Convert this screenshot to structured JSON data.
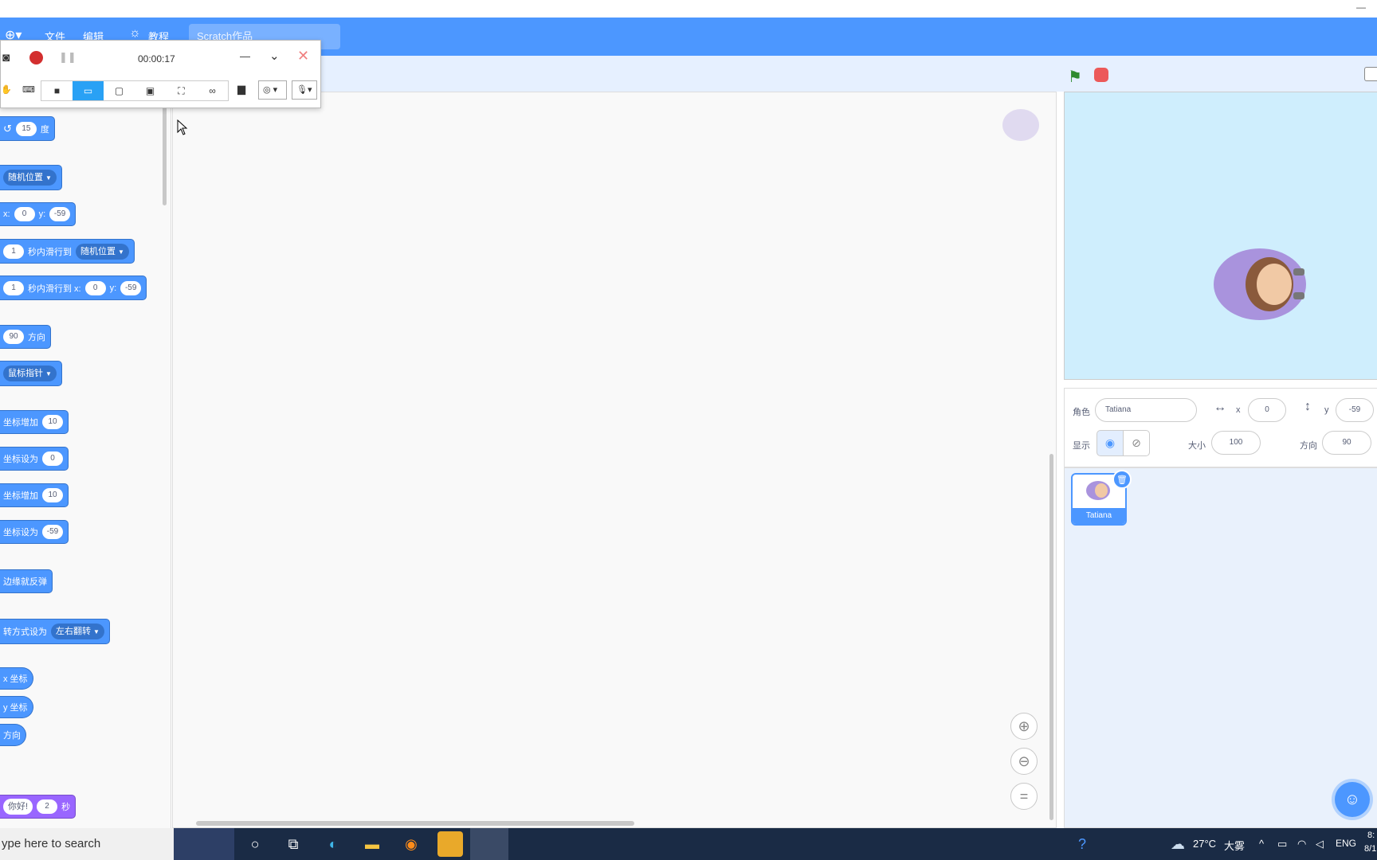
{
  "menubar": {
    "file": "文件",
    "edit": "编辑",
    "tutorials": "教程",
    "project_title": "Scratch作品"
  },
  "recorder": {
    "timer": "00:00:17"
  },
  "palette": {
    "turn_degrees": "15",
    "turn_unit": "度",
    "goto_random": "随机位置",
    "goto_x_label": "x:",
    "goto_x": "0",
    "goto_y_label": "y:",
    "goto_y": "-59",
    "glide_secs": "1",
    "glide_text": "秒内滑行到",
    "glide_random": "随机位置",
    "glide2_secs": "1",
    "glide2_text": "秒内滑行到 x:",
    "glide2_x": "0",
    "glide2_y_label": "y:",
    "glide2_y": "-59",
    "direction_value": "90",
    "direction_text": "方向",
    "point_towards": "鼠标指针",
    "change_x_text": "坐标增加",
    "change_x_value": "10",
    "set_x_text": "坐标设为",
    "set_x_value": "0",
    "change_y_text": "坐标增加",
    "change_y_value": "10",
    "set_y_text": "坐标设为",
    "set_y_value": "-59",
    "bounce_text": "边缘就反弹",
    "rotation_text": "转方式设为",
    "rotation_value": "左右翻转",
    "x_position": "x 坐标",
    "y_position": "y 坐标",
    "direction_reporter": "方向",
    "say_text": "你好!",
    "say_secs": "2",
    "say_unit": "秒"
  },
  "sprite_info": {
    "sprite_label": "角色",
    "sprite_name": "Tatiana",
    "x_label": "x",
    "x_value": "0",
    "y_label": "y",
    "y_value": "-59",
    "show_label": "显示",
    "size_label": "大小",
    "size_value": "100",
    "direction_label": "方向",
    "direction_value": "90"
  },
  "sprite_list": {
    "sprites": [
      {
        "name": "Tatiana"
      }
    ]
  },
  "taskbar": {
    "search_placeholder": "ype here to search",
    "weather_temp": "27°C",
    "weather_desc": "大雾",
    "language": "ENG",
    "clock_line1": "8:",
    "clock_line2": "8/1"
  },
  "colors": {
    "motion_blue": "#4c97ff",
    "looks_purple": "#9966ff",
    "stage_bg": "#cfeefd",
    "taskbar": "#1a2b45"
  }
}
